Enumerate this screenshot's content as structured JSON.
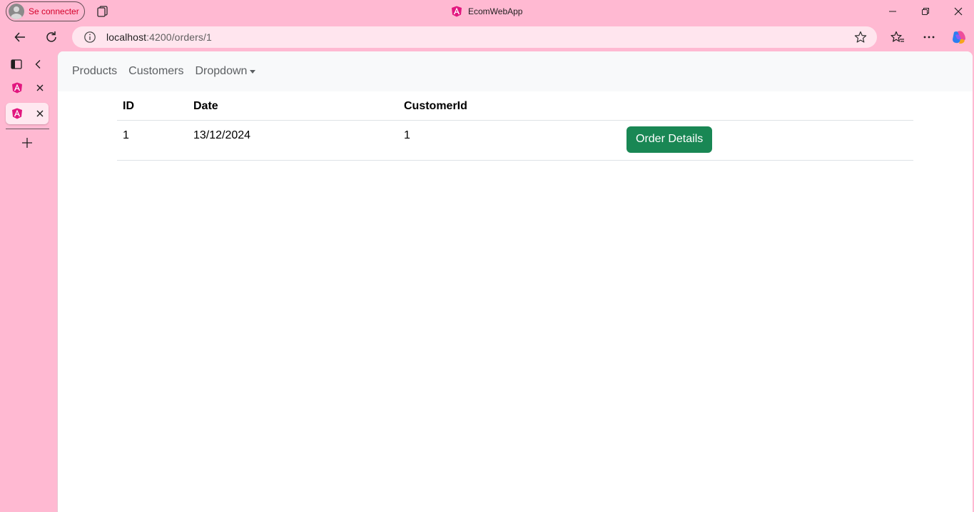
{
  "browser": {
    "profile_label": "Se connecter",
    "window_title": "EcomWebApp",
    "url_host": "localhost",
    "url_path": ":4200/orders/1",
    "icons": [
      "workspaces-icon",
      "angular-icon",
      "minimize-icon",
      "restore-icon",
      "close-icon",
      "back-arrow-icon",
      "refresh-icon",
      "info-icon",
      "star-icon",
      "favorites-icon",
      "more-icon",
      "copilot-icon",
      "sidebar-toggle-icon",
      "chevron-left-icon",
      "plus-icon"
    ]
  },
  "navbar": {
    "links": [
      {
        "label": "Products"
      },
      {
        "label": "Customers"
      },
      {
        "label": "Dropdown"
      }
    ]
  },
  "orders": {
    "headers": [
      "ID",
      "Date",
      "CustomerId"
    ],
    "rows": [
      {
        "id": "1",
        "date": "13/12/2024",
        "customer_id": "1",
        "action_label": "Order Details"
      }
    ]
  },
  "colors": {
    "browser_frame": "#ffb9d2",
    "navbar_bg": "#f8f9fa",
    "button_success": "#198754",
    "profile_text": "#d4002a"
  }
}
